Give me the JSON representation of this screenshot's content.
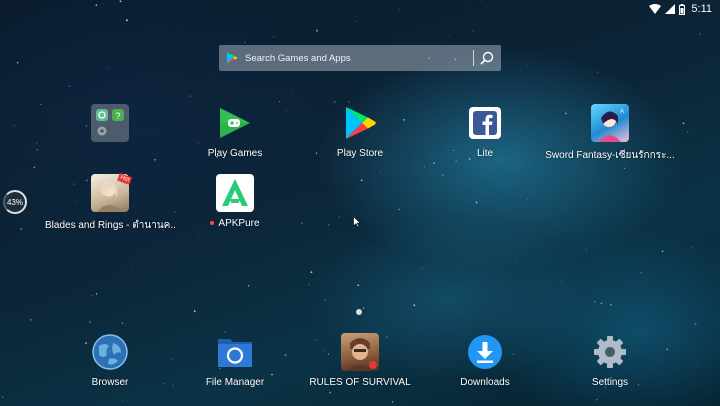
{
  "status_bar": {
    "time": "5:11",
    "icons": [
      "wifi-icon",
      "signal-icon",
      "battery-icon"
    ]
  },
  "search": {
    "placeholder": "Search Games and Apps",
    "icons": [
      "play-store-icon",
      "search-icon"
    ]
  },
  "side_badge": {
    "text": "43%"
  },
  "apps_row1": [
    {
      "label": "",
      "icon": "folder-icon"
    },
    {
      "label": "Play Games",
      "icon": "play-games-icon"
    },
    {
      "label": "Play Store",
      "icon": "play-store-icon"
    },
    {
      "label": "Lite",
      "icon": "facebook-lite-icon"
    },
    {
      "label": "Sword Fantasy-เซียนรักกระ...",
      "icon": "sword-fantasy-icon"
    }
  ],
  "apps_row2": [
    {
      "label": "Blades and Rings - ตำนานค...",
      "icon": "blades-and-rings-icon",
      "badge": "Hot"
    },
    {
      "label": "APKPure",
      "icon": "apkpure-icon"
    }
  ],
  "dock": [
    {
      "label": "Browser",
      "icon": "browser-icon"
    },
    {
      "label": "File Manager",
      "icon": "file-manager-icon"
    },
    {
      "label": "RULES OF SURVIVAL",
      "icon": "rules-of-survival-icon"
    },
    {
      "label": "Downloads",
      "icon": "downloads-icon"
    },
    {
      "label": "Settings",
      "icon": "settings-icon"
    }
  ],
  "colors": {
    "play_games_green": "#2bb34a",
    "facebook_blue": "#3b5998",
    "apkpure_green": "#24cd77",
    "downloads_blue": "#2196f3",
    "file_manager_blue": "#2d7ad6"
  }
}
